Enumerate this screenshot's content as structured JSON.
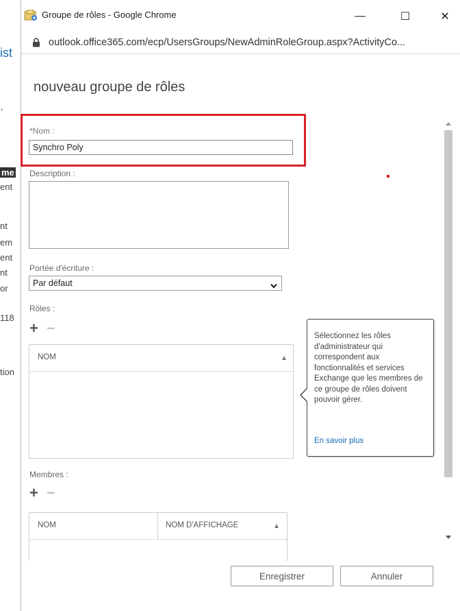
{
  "background": {
    "fragments": [
      "ist",
      "me",
      "ent",
      "nt",
      "em",
      "ent",
      "nt",
      "or",
      "118",
      "tion"
    ]
  },
  "window": {
    "title": "Groupe de rôles - Google Chrome",
    "url": "outlook.office365.com/ecp/UsersGroups/NewAdminRoleGroup.aspx?ActivityCo...",
    "controls": {
      "minimize": "—",
      "maximize": "☐",
      "close": "✕"
    }
  },
  "form": {
    "title": "nouveau groupe de rôles",
    "name": {
      "label": "*Nom :",
      "value": "Synchro Poly"
    },
    "description": {
      "label": "Description :",
      "value": ""
    },
    "write_scope": {
      "label": "Portée d'écriture :",
      "value": "Par défaut"
    },
    "roles": {
      "label": "Rôles :",
      "add": "+",
      "remove": "−",
      "columns": [
        "NOM"
      ]
    },
    "members": {
      "label": "Membres :",
      "add": "+",
      "remove": "−",
      "columns": [
        "NOM",
        "NOM D'AFFICHAGE"
      ]
    }
  },
  "tooltip": {
    "text": "Sélectionnez les rôles d'administrateur qui correspondent aux fonctionnalités et services Exchange que les membres de ce groupe de rôles doivent pouvoir gérer.",
    "link": "En savoir plus"
  },
  "buttons": {
    "save": "Enregistrer",
    "cancel": "Annuler"
  },
  "colors": {
    "highlight": "#d9222a",
    "link": "#1a6bb5"
  }
}
